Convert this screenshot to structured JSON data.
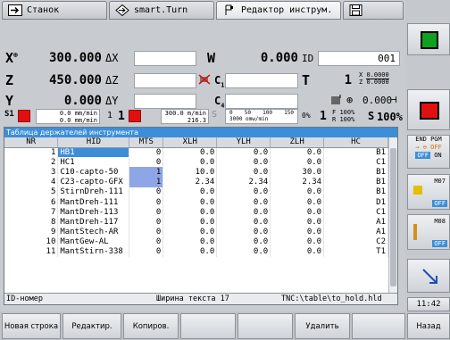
{
  "tabs": [
    {
      "label": "Станок",
      "icon": "arrow-right-icon"
    },
    {
      "label": "smart.Turn",
      "icon": "diamond-arrow-icon"
    },
    {
      "label": "Редактор инструм.",
      "icon": "tool-icon"
    },
    {
      "label": "",
      "icon": "save-icon"
    }
  ],
  "positions": {
    "x": {
      "axis": "X",
      "sup": "⊕",
      "value": "300.000",
      "delta": "ΔX"
    },
    "z": {
      "axis": "Z",
      "value": "450.000",
      "delta": "ΔZ"
    },
    "y": {
      "axis": "Y",
      "value": "0.000",
      "delta": "ΔY"
    },
    "w": {
      "axis": "W",
      "value": "0.000",
      "label": "ID",
      "id_value": "001"
    },
    "c1": {
      "axis": "C",
      "sub": "1"
    },
    "c4": {
      "axis": "C",
      "sub": "4"
    },
    "t": {
      "axis": "T",
      "value": "1",
      "x_off": "0.0000",
      "z_off": "0.0000",
      "x_label": "X",
      "z_label": "Z"
    },
    "ang": {
      "value": "0.000"
    }
  },
  "feed": {
    "s_label": "S1",
    "f1": "0.0 mm/min",
    "f2": "0.0 mm/min",
    "spindle": "1",
    "spindle2": "1",
    "rpm": "300.0 m/min",
    "rpm2": "216.3",
    "s_dim": "S",
    "scale_ticks": [
      "0",
      "50",
      "100",
      "150"
    ],
    "scale_val": "3000 omw/min",
    "pct": "0%",
    "f_ovr": "100%",
    "r_ovr": "100%",
    "s_label2": "S",
    "s_ovr": "100%",
    "f_letter": "F",
    "r_letter": "R",
    "one": "1"
  },
  "table": {
    "caption": "Таблица держателей инструмента",
    "columns": [
      "NR",
      "HID",
      "MTS",
      "XLH",
      "YLH",
      "ZLH",
      "HC"
    ],
    "rows": [
      [
        "1",
        "HB1",
        "0",
        "0.0",
        "0.0",
        "0.0",
        "B1"
      ],
      [
        "2",
        "HC1",
        "0",
        "0.0",
        "0.0",
        "0.0",
        "C1"
      ],
      [
        "3",
        "C10-capto-50",
        "1",
        "10.0",
        "0.0",
        "30.0",
        "B1"
      ],
      [
        "4",
        "C23-capto-GFX",
        "1",
        "2.34",
        "2.34",
        "2.34",
        "B1"
      ],
      [
        "5",
        "StirnDreh-111",
        "0",
        "0.0",
        "0.0",
        "0.0",
        "B1"
      ],
      [
        "6",
        "MantDreh-111",
        "0",
        "0.0",
        "0.0",
        "0.0",
        "D1"
      ],
      [
        "7",
        "MantDreh-113",
        "0",
        "0.0",
        "0.0",
        "0.0",
        "C1"
      ],
      [
        "8",
        "MantDreh-117",
        "0",
        "0.0",
        "0.0",
        "0.0",
        "A1"
      ],
      [
        "9",
        "MantStech-AR",
        "0",
        "0.0",
        "0.0",
        "0.0",
        "A1"
      ],
      [
        "10",
        "MantGew-AL",
        "0",
        "0.0",
        "0.0",
        "0.0",
        "C2"
      ],
      [
        "11",
        "MantStirn-338",
        "0",
        "0.0",
        "0.0",
        "0.0",
        "T1"
      ]
    ],
    "status_field": "ID-номер",
    "status_width": "Ширина текста 17",
    "status_path": "TNC:\\table\\to_hold.hld"
  },
  "softkeys": [
    "Новая строка",
    "Редактир.",
    "Копиров.",
    "",
    "",
    "Удалить",
    "",
    "Назад"
  ],
  "side": {
    "end_pgm": "END PGM",
    "off": "OFF",
    "on": "ON",
    "m07": "M07",
    "m08": "M08",
    "clock": "11:42"
  },
  "colors": {
    "accent": "#3d8ed8",
    "danger": "#e01010",
    "ok": "#0ea01e"
  }
}
